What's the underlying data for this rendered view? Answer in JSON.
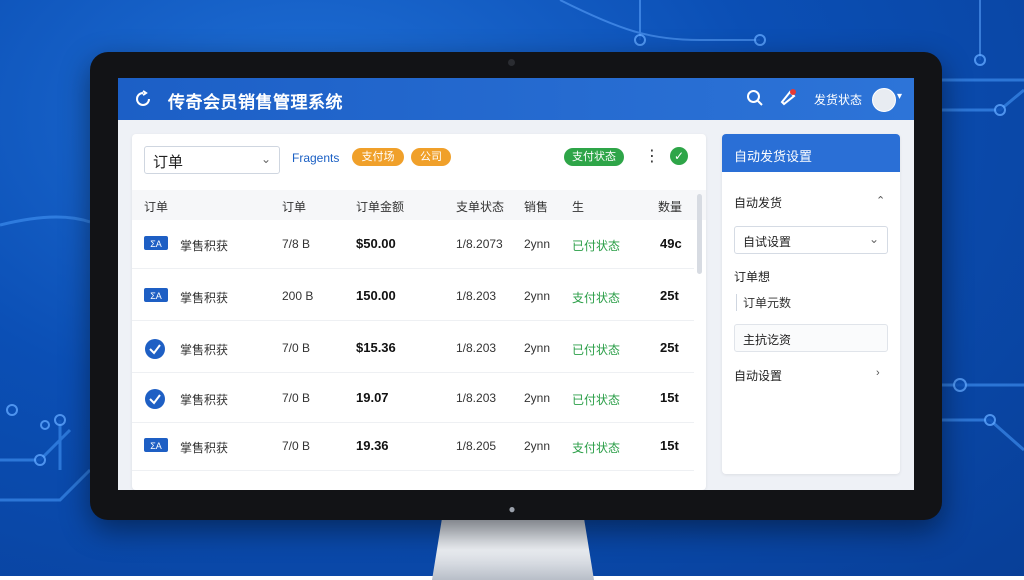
{
  "colors": {
    "brand": "#1c5fc6",
    "accent_orange": "#f0a02a",
    "success": "#2ea548"
  },
  "app": {
    "title": "传奇会员销售管理系统",
    "logo_icon": "refresh-logo-icon"
  },
  "topbar": {
    "status_label": "发货状态",
    "search_icon": "search-icon",
    "notify_icon": "notification-icon"
  },
  "toolbar": {
    "filter_value": "订单",
    "link_label": "Fragents",
    "tag_1": "支付场",
    "tag_2": "公司",
    "status_tag": "支付状态",
    "more_icon": "more-vertical-icon",
    "confirm_icon": "check-circle-icon"
  },
  "table": {
    "headers": [
      "订单",
      "订单",
      "订单金额",
      "支单状态",
      "销售",
      "生",
      "数量"
    ],
    "rows": [
      {
        "icon": "id-card-icon",
        "name": "掌售积获",
        "id": "7/8 B",
        "price": "$50.00",
        "date": "1/8.2073",
        "user": "2ynn",
        "status": "已付状态",
        "qty": "49c"
      },
      {
        "icon": "id-card-icon",
        "name": "掌售积获",
        "id": "200 B",
        "price": "150.00",
        "date": "1/8.203",
        "user": "2ynn",
        "status": "支付状态",
        "qty": "25t"
      },
      {
        "icon": "shield-check-icon",
        "name": "掌售积获",
        "id": "7/0 B",
        "price": "$15.36",
        "date": "1/8.203",
        "user": "2ynn",
        "status": "已付状态",
        "qty": "25t"
      },
      {
        "icon": "shield-check-icon",
        "name": "掌售积获",
        "id": "7/0 B",
        "price": "19.07",
        "date": "1/8.203",
        "user": "2ynn",
        "status": "已付状态",
        "qty": "15t"
      },
      {
        "icon": "id-card-icon",
        "name": "掌售积获",
        "id": "7/0 B",
        "price": "19.36",
        "date": "1/8.205",
        "user": "2ynn",
        "status": "支付状态",
        "qty": "15t"
      }
    ]
  },
  "side": {
    "title": "自动发货设置",
    "section_1": "自动发货",
    "select_value": "自试设置",
    "section_2": "订单想",
    "item_1": "订单元数",
    "input_value": "主抗讫资",
    "section_3": "自动设置"
  }
}
